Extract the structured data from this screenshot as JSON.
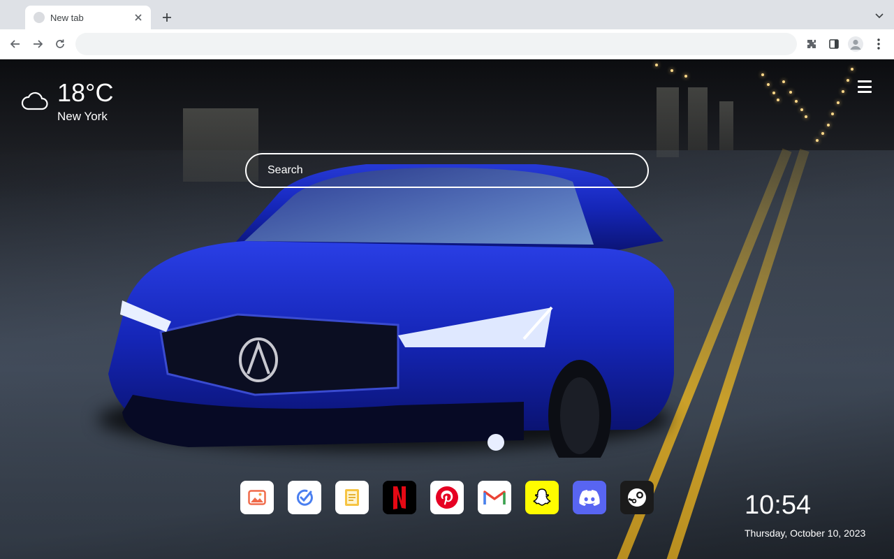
{
  "browser": {
    "tab_title": "New tab",
    "omnibox": {
      "value": "",
      "placeholder": ""
    }
  },
  "weather": {
    "temperature": "18°C",
    "city": "New York",
    "icon": "cloud-icon"
  },
  "search": {
    "placeholder": "Search"
  },
  "shortcuts": [
    {
      "name": "photos",
      "icon": "image-icon",
      "bg": "#ffffff"
    },
    {
      "name": "tasks",
      "icon": "check-circle-icon",
      "bg": "#ffffff"
    },
    {
      "name": "notes",
      "icon": "note-icon",
      "bg": "#ffffff"
    },
    {
      "name": "netflix",
      "icon": "netflix-icon",
      "bg": "#000000"
    },
    {
      "name": "pinterest",
      "icon": "pinterest-icon",
      "bg": "#ffffff"
    },
    {
      "name": "gmail",
      "icon": "gmail-icon",
      "bg": "#ffffff"
    },
    {
      "name": "snapchat",
      "icon": "snapchat-icon",
      "bg": "#fffc00"
    },
    {
      "name": "discord",
      "icon": "discord-icon",
      "bg": "#5865f2"
    },
    {
      "name": "steam",
      "icon": "steam-icon",
      "bg": "#1b1b1b"
    }
  ],
  "clock": {
    "time": "10:54",
    "date": "Thursday, October 10, 2023"
  },
  "colors": {
    "tabstrip": "#dee1e6",
    "accent_blue": "#1a2fd6",
    "lane_yellow": "#caa02a"
  }
}
